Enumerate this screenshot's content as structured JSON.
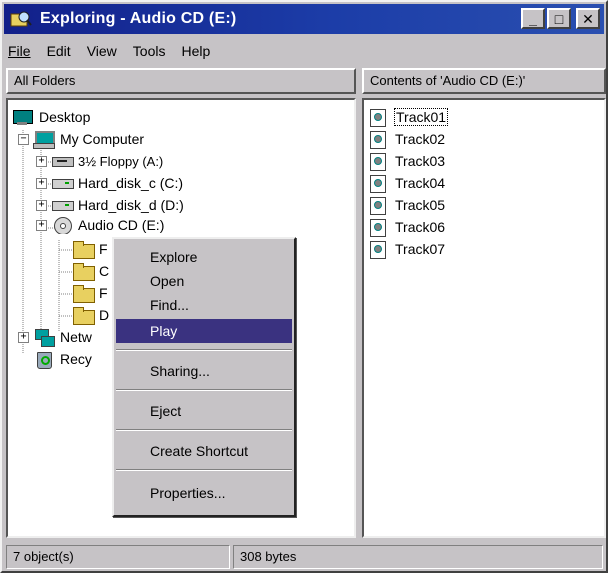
{
  "window": {
    "title": "Exploring - Audio CD (E:)",
    "controls": {
      "minimize": "_",
      "maximize": "□",
      "close": "✕"
    }
  },
  "menubar": {
    "items": [
      {
        "label": "File",
        "icon": ""
      },
      {
        "label": "Edit"
      },
      {
        "label": "View"
      },
      {
        "label": "Tools"
      },
      {
        "label": "Help"
      }
    ]
  },
  "left_pane": {
    "header": "All Folders",
    "tree": [
      {
        "label": "Desktop",
        "icon": "desktop-icon",
        "expander": ""
      },
      {
        "label": "My Computer",
        "icon": "computer-icon",
        "expander": "−"
      },
      {
        "label": "3½ Floppy (A:)",
        "icon": "floppy-drive-icon",
        "expander": "+"
      },
      {
        "label": "Hard_disk_c (C:)",
        "icon": "hard-disk-icon",
        "expander": "+"
      },
      {
        "label": "Hard_disk_d (D:)",
        "icon": "hard-disk-icon",
        "expander": "+"
      },
      {
        "label": "Audio CD (E:)",
        "icon": "cd-drive-icon",
        "expander": "+"
      },
      {
        "label": "F",
        "icon": "folder-icon",
        "expander": ""
      },
      {
        "label": "C",
        "icon": "folder-icon",
        "expander": ""
      },
      {
        "label": "F",
        "icon": "folder-icon",
        "expander": ""
      },
      {
        "label": "D",
        "icon": "folder-icon",
        "expander": ""
      },
      {
        "label": "Netw",
        "icon": "network-icon",
        "expander": "+"
      },
      {
        "label": "Recy",
        "icon": "recycle-bin-icon",
        "expander": ""
      }
    ]
  },
  "right_pane": {
    "header": "Contents of 'Audio CD (E:)'",
    "items": [
      {
        "label": "Track01"
      },
      {
        "label": "Track02"
      },
      {
        "label": "Track03"
      },
      {
        "label": "Track04"
      },
      {
        "label": "Track05"
      },
      {
        "label": "Track06"
      },
      {
        "label": "Track07"
      }
    ]
  },
  "context_menu": {
    "items": [
      {
        "label": "Explore"
      },
      {
        "label": "Open"
      },
      {
        "label": "Find..."
      },
      {
        "label": "Play"
      },
      {
        "label": "Sharing..."
      },
      {
        "label": "Eject"
      },
      {
        "label": "Create Shortcut"
      },
      {
        "label": "Properties..."
      }
    ],
    "selected": "Play"
  },
  "statusbar": {
    "objects": "7 object(s)",
    "size": "308 bytes"
  }
}
